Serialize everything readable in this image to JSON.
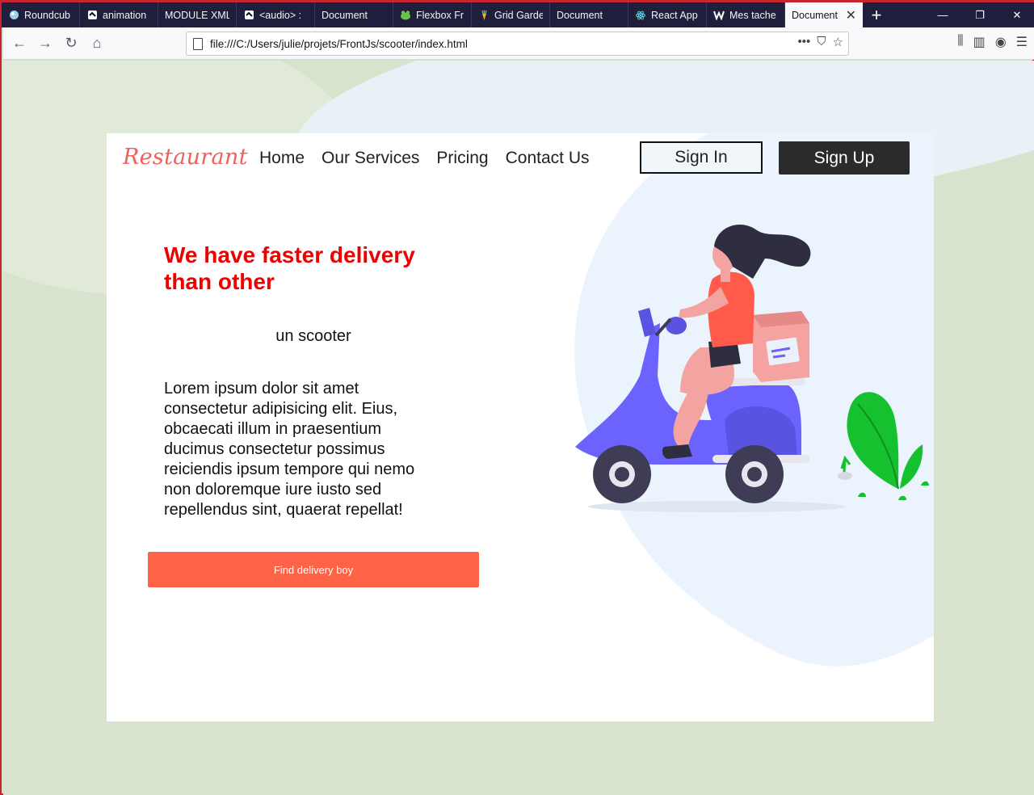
{
  "browser": {
    "tabs": [
      {
        "label": "Roundcub",
        "icon": "roundcube-icon"
      },
      {
        "label": "animation",
        "icon": "codepen-icon"
      },
      {
        "label": "MODULE XML",
        "icon": ""
      },
      {
        "label": "<audio> :",
        "icon": "codepen-icon"
      },
      {
        "label": "Document",
        "icon": ""
      },
      {
        "label": "Flexbox Fr",
        "icon": "frog-icon"
      },
      {
        "label": "Grid Garde",
        "icon": "carrot-icon"
      },
      {
        "label": "Document",
        "icon": ""
      },
      {
        "label": "React App",
        "icon": "react-icon"
      },
      {
        "label": "Mes tache",
        "icon": "webflow-icon"
      }
    ],
    "active_tab": {
      "label": "Document"
    },
    "url": "file:///C:/Users/julie/projets/FrontJs/scooter/index.html"
  },
  "page": {
    "brand": "Restaurant",
    "nav": [
      "Home",
      "Our Services",
      "Pricing",
      "Contact Us"
    ],
    "sign_in": "Sign In",
    "sign_up": "Sign Up",
    "hero_title": "We have faster delivery than other",
    "subtitle": "un scooter",
    "body": "Lorem ipsum dolor sit amet consectetur adipisicing elit. Eius, obcaecati illum in praesentium ducimus consectetur possimus reiciendis ipsum tempore qui nemo non doloremque iure iusto sed repellendus sint, quaerat repellat!",
    "cta": "Find delivery boy"
  },
  "colors": {
    "accent": "#ff6347",
    "title": "#ee0000",
    "brand": "#f0605a",
    "scooter": "#6c63ff"
  }
}
